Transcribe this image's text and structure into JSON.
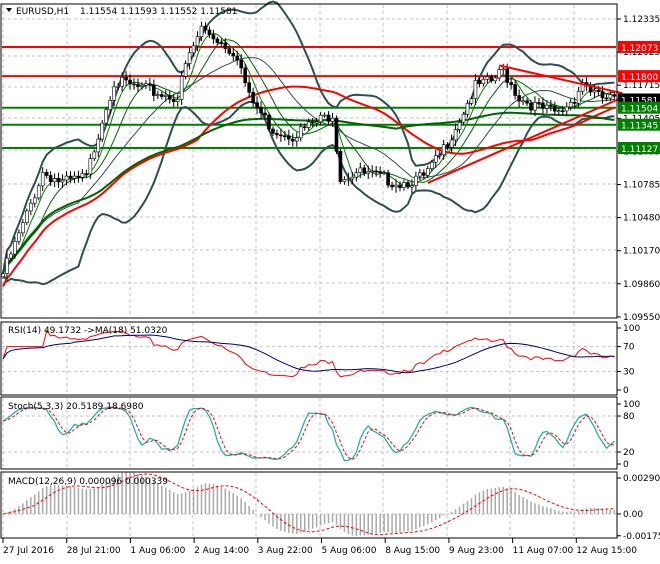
{
  "header": {
    "symbol": "EURUSD,H1",
    "ohlc": "1.11554 1.11593 1.11552 1.11581"
  },
  "price_axis": [
    "1.12335",
    "1.12025",
    "1.11715",
    "1.11405",
    "1.11095",
    "1.10785",
    "1.10480",
    "1.10170",
    "1.09860",
    "1.09550"
  ],
  "levels": [
    {
      "label": "1.12073",
      "price": 1.12073,
      "line": "#ff0000",
      "bg": "#ff0000"
    },
    {
      "label": "1.11800",
      "price": 1.118,
      "line": "#ff0000",
      "bg": "#ff0000"
    },
    {
      "label": "1.11581",
      "price": 1.11581,
      "line": null,
      "bg": "#000000"
    },
    {
      "label": "1.11504",
      "price": 1.11504,
      "line": "#008000",
      "bg": "#008000"
    },
    {
      "label": "1.11345",
      "price": 1.11345,
      "line": "#008000",
      "bg": "#008000"
    },
    {
      "label": "1.11127",
      "price": 1.11127,
      "line": "#008000",
      "bg": "#008000"
    }
  ],
  "time_axis": [
    "27 Jul 2016",
    "28 Jul 21:00",
    "1 Aug 06:00",
    "2 Aug 14:00",
    "3 Aug 22:00",
    "5 Aug 06:00",
    "8 Aug 15:00",
    "9 Aug 23:00",
    "11 Aug 07:00",
    "12 Aug 15:00"
  ],
  "rsi": {
    "title": "RSI(14) 49.1732  ->MA(18) 51.0320",
    "axis": [
      "100",
      "70",
      "30",
      "0"
    ]
  },
  "stoch": {
    "title": "Stoch(5,3,3) 20.5189 18.6980",
    "axis": [
      "100",
      "80",
      "20",
      "0"
    ]
  },
  "macd": {
    "title": "MACD(12,26,9) 0.000096 0.000339",
    "axis": [
      "0.002904",
      "0.00",
      "-0.001759"
    ]
  },
  "chart_data": {
    "type": "candlestick",
    "bars": 155,
    "price_range": [
      1.0955,
      1.1245
    ],
    "keypoints": [
      [
        0,
        1.0995
      ],
      [
        5,
        1.104
      ],
      [
        10,
        1.109
      ],
      [
        15,
        1.108
      ],
      [
        21,
        1.1085
      ],
      [
        25,
        1.114
      ],
      [
        28,
        1.1175
      ],
      [
        33,
        1.117
      ],
      [
        38,
        1.1165
      ],
      [
        44,
        1.116
      ],
      [
        46,
        1.119
      ],
      [
        50,
        1.1225
      ],
      [
        54,
        1.1215
      ],
      [
        59,
        1.12
      ],
      [
        62,
        1.116
      ],
      [
        68,
        1.113
      ],
      [
        73,
        1.1125
      ],
      [
        78,
        1.1135
      ],
      [
        83,
        1.1145
      ],
      [
        85,
        1.1085
      ],
      [
        89,
        1.109
      ],
      [
        95,
        1.1085
      ],
      [
        100,
        1.108
      ],
      [
        106,
        1.1085
      ],
      [
        110,
        1.1105
      ],
      [
        115,
        1.114
      ],
      [
        119,
        1.117
      ],
      [
        123,
        1.1175
      ],
      [
        126,
        1.1185
      ],
      [
        130,
        1.116
      ],
      [
        135,
        1.115
      ],
      [
        140,
        1.1145
      ],
      [
        144,
        1.116
      ],
      [
        146,
        1.1175
      ],
      [
        150,
        1.116
      ],
      [
        154,
        1.1158
      ]
    ],
    "trendlines": [
      {
        "from": [
          125,
          1.119
        ],
        "to": [
          154,
          1.1164
        ],
        "color": "#ff0000"
      },
      {
        "from": [
          107,
          1.108
        ],
        "to": [
          154,
          1.116
        ],
        "color": "#ff0000"
      }
    ]
  }
}
